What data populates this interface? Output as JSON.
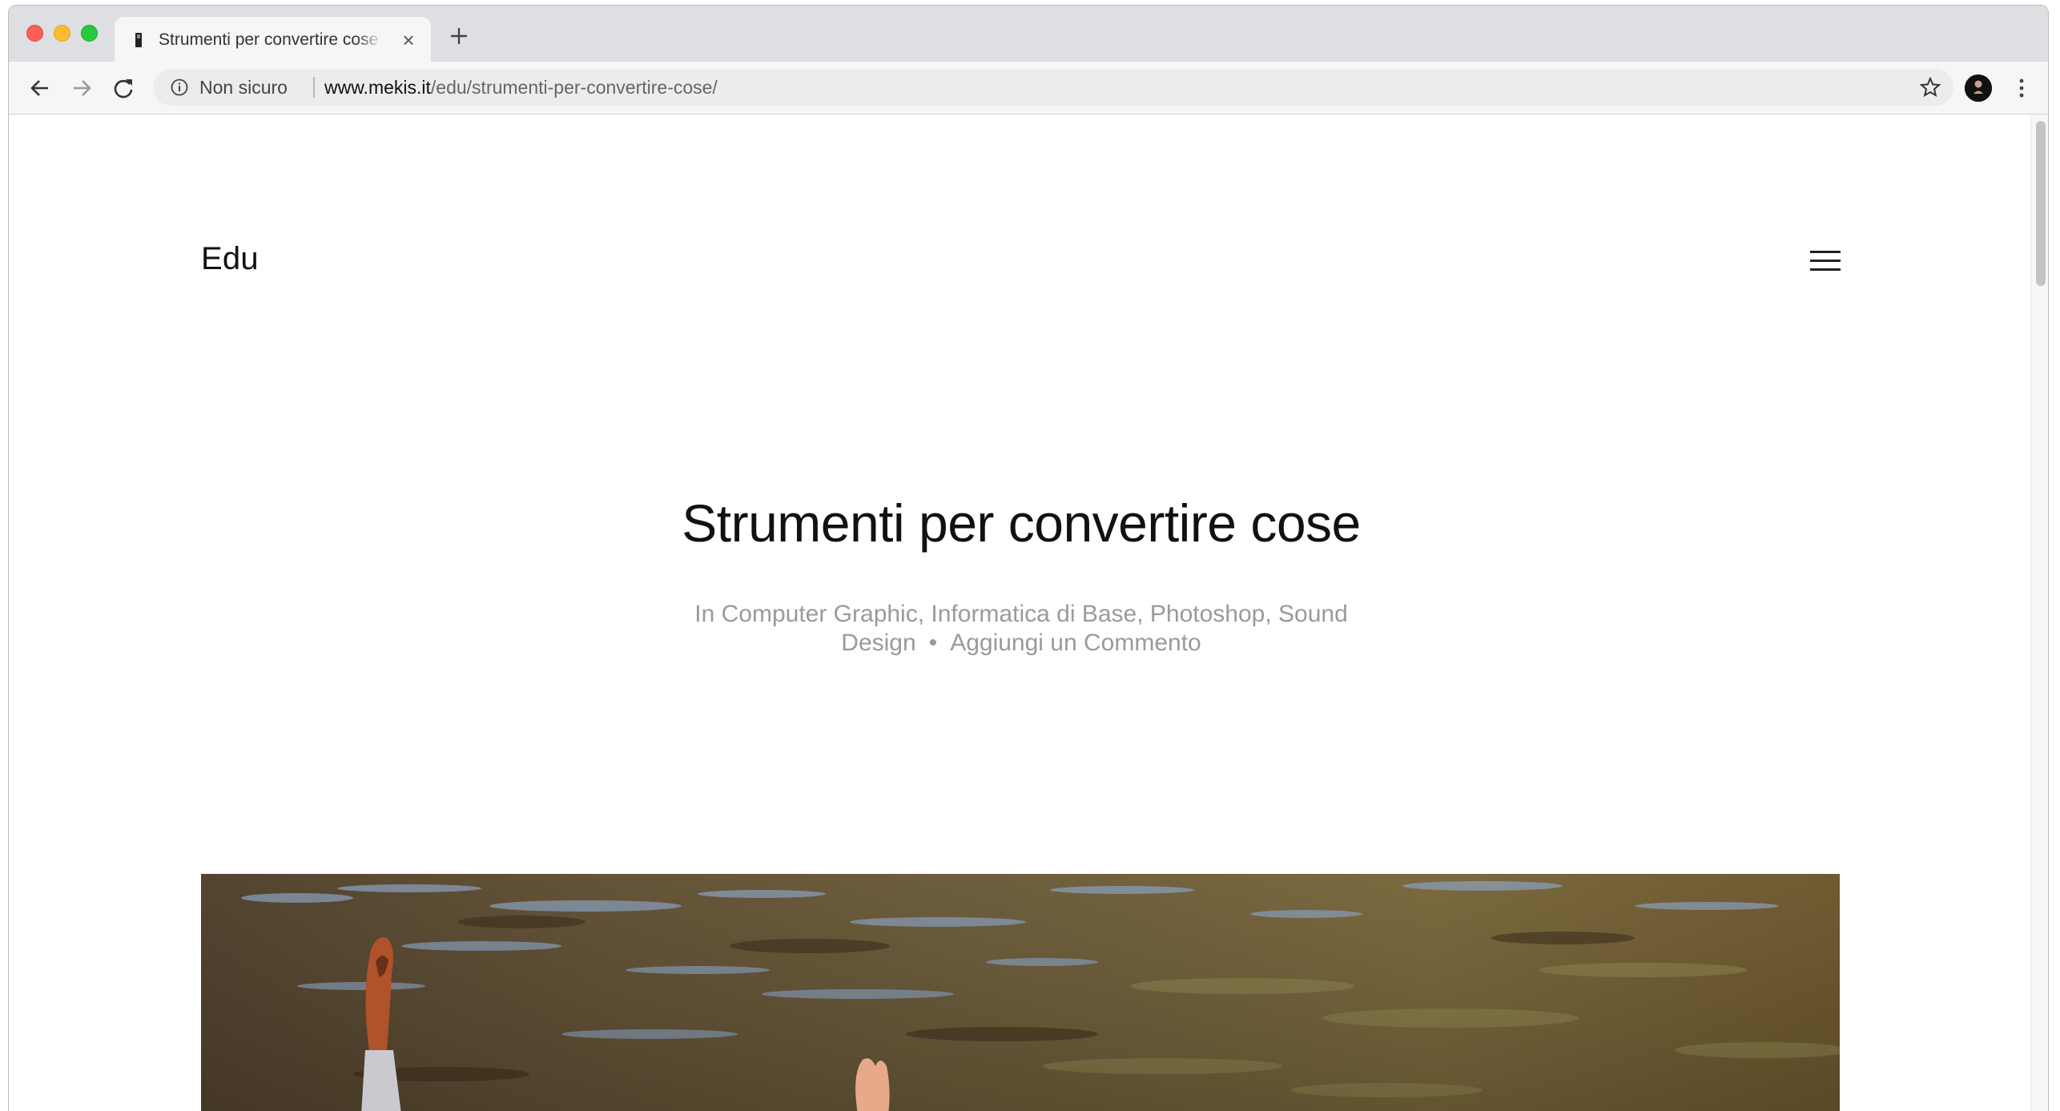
{
  "browser": {
    "tab": {
      "title": "Strumenti per convertire cose – Edu",
      "close_glyph": "×"
    },
    "toolbar": {
      "security_label": "Non sicuro",
      "url_host": "www.mekis.it",
      "url_path": "/edu/strumenti-per-convertire-cose/"
    }
  },
  "site": {
    "title": "Edu"
  },
  "post": {
    "title": "Strumenti per convertire cose",
    "meta": {
      "prefix": "In",
      "categories": [
        "Computer Graphic",
        "Informatica di Base",
        "Photoshop",
        "Sound Design"
      ],
      "separator": "•",
      "comments_link": "Aggiungi un Commento"
    }
  },
  "icons": {
    "back": "arrow-left-icon",
    "forward": "arrow-right-icon",
    "reload": "reload-icon",
    "info": "info-icon",
    "star": "star-icon",
    "menu": "hamburger-icon",
    "more": "vertical-dots-icon",
    "new_tab": "plus-icon"
  },
  "colors": {
    "tabstrip": "#dedfe2",
    "toolbar": "#f6f6f6",
    "meta_text": "#9a9a9a",
    "traffic_close": "#fe5f57",
    "traffic_min": "#febc2e",
    "traffic_max": "#28c840"
  }
}
